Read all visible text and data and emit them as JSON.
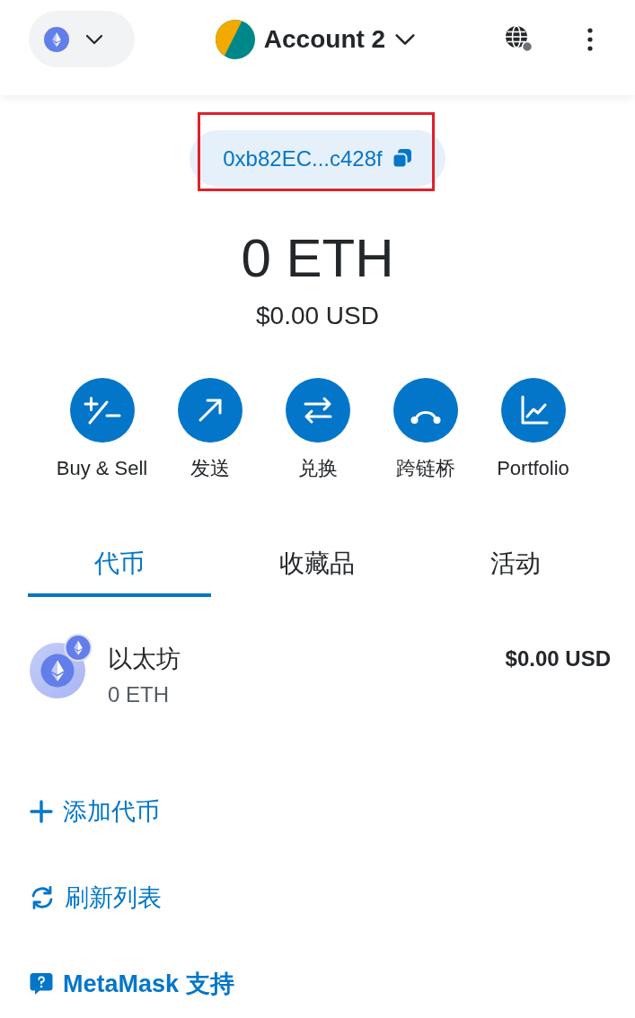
{
  "header": {
    "account": "Account 2"
  },
  "address": {
    "text": "0xb82EC...c428f",
    "highlighted": true
  },
  "balance": {
    "primary": "0 ETH",
    "secondary": "$0.00 USD"
  },
  "actions": [
    {
      "kind": "buy-sell",
      "label": "Buy & Sell"
    },
    {
      "kind": "send",
      "label": "发送"
    },
    {
      "kind": "swap",
      "label": "兑换"
    },
    {
      "kind": "bridge",
      "label": "跨链桥"
    },
    {
      "kind": "portfolio",
      "label": "Portfolio"
    }
  ],
  "tabs": [
    {
      "label": "代币",
      "selected": true
    },
    {
      "label": "收藏品",
      "selected": false
    },
    {
      "label": "活动",
      "selected": false
    }
  ],
  "tokens": [
    {
      "name": "以太坊",
      "amount": "0 ETH",
      "value": "$0.00 USD"
    }
  ],
  "links": [
    {
      "kind": "add",
      "label": "添加代币"
    },
    {
      "kind": "refresh",
      "label": "刷新列表"
    },
    {
      "kind": "support",
      "label": "MetaMask 支持"
    }
  ]
}
